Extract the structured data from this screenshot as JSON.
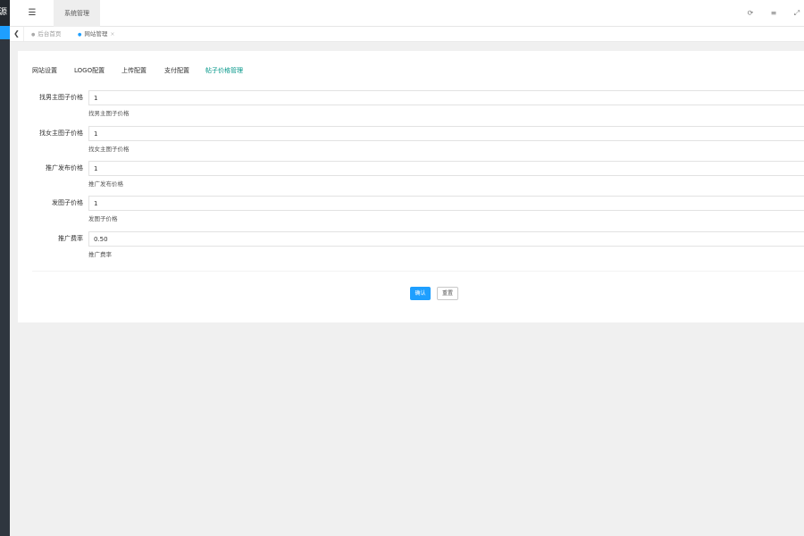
{
  "sidebar": {
    "logo": "源",
    "accent_color": "#1e9fff"
  },
  "topbar": {
    "menu_icon": "hamburger-icon",
    "active_tab": "系统管理",
    "controls": [
      {
        "name": "refresh-icon",
        "glyph": "⟳"
      },
      {
        "name": "more-icon",
        "glyph": "≡"
      },
      {
        "name": "fullscreen-icon",
        "glyph": "⤢"
      }
    ]
  },
  "page_tabs": {
    "back_icon": "chevron-left-icon",
    "home": "后台首页",
    "current": "网站管理"
  },
  "settings": {
    "subtabs": [
      "网站设置",
      "LOGO配置",
      "上传配置",
      "支付配置",
      "帖子价格管理"
    ],
    "active_subtab": "帖子价格管理",
    "active_color": "#009688",
    "fields": [
      {
        "label": "找男主图子价格",
        "value": "1",
        "hint": "找男主图子价格"
      },
      {
        "label": "找女主图子价格",
        "value": "1",
        "hint": "找女主图子价格"
      },
      {
        "label": "推广发布价格",
        "value": "1",
        "hint": "推广发布价格"
      },
      {
        "label": "发图子价格",
        "value": "1",
        "hint": "发图子价格"
      },
      {
        "label": "推广费率",
        "value": "0.50",
        "hint": "推广费率"
      }
    ],
    "confirm_label": "确认",
    "reset_label": "重置",
    "confirm_color": "#1e9fff"
  }
}
